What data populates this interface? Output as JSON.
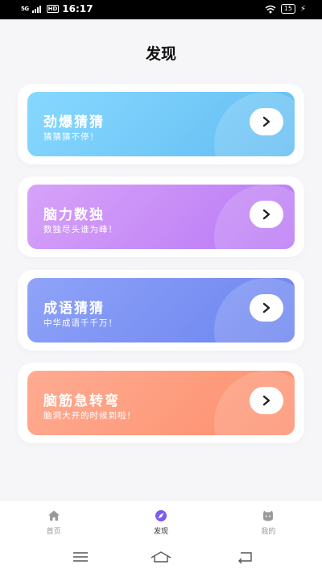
{
  "status_bar": {
    "signal_label": "5G",
    "hd_label": "HD",
    "time": "16:17",
    "battery": "15",
    "icons": [
      "signal-icon",
      "wifi-icon",
      "battery-icon",
      "charging-icon"
    ]
  },
  "page": {
    "title": "发现"
  },
  "cards": [
    {
      "title": "劲爆猜猜",
      "subtitle": "猜猜猜不停！",
      "icon": "chevron-right-icon",
      "color": "#6ec7f6"
    },
    {
      "title": "脑力数独",
      "subtitle": "数独尽头谁为峰！",
      "icon": "chevron-right-icon",
      "color": "#c68af7"
    },
    {
      "title": "成语猜猜",
      "subtitle": "中华成语千千万！",
      "icon": "chevron-right-icon",
      "color": "#7b92f3"
    },
    {
      "title": "脑筋急转弯",
      "subtitle": "脑洞大开的时候到啦！",
      "icon": "chevron-right-icon",
      "color": "#fe9b7c"
    }
  ],
  "tabs": [
    {
      "label": "首页",
      "icon": "home-icon",
      "active": false
    },
    {
      "label": "发现",
      "icon": "compass-icon",
      "active": true,
      "color": "#7c5cf0"
    },
    {
      "label": "我的",
      "icon": "profile-icon",
      "active": false
    }
  ],
  "system_nav": [
    "menu-icon",
    "home-outline-icon",
    "back-icon"
  ]
}
